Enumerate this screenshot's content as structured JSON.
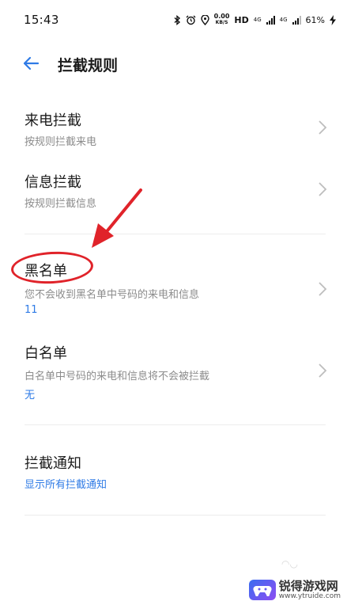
{
  "status_bar": {
    "time": "15:43",
    "net_speed_value": "0.00",
    "net_speed_unit": "KB/S",
    "hd_label": "HD",
    "network_1": "4G",
    "network_2": "4G",
    "battery": "61%"
  },
  "header": {
    "title": "拦截规则"
  },
  "rows": [
    {
      "title": "来电拦截",
      "subtitle": "按规则拦截来电"
    },
    {
      "title": "信息拦截",
      "subtitle": "按规则拦截信息"
    },
    {
      "title": "黑名单",
      "subtitle": "您不会收到黑名单中号码的来电和信息",
      "value": "11"
    },
    {
      "title": "白名单",
      "subtitle": "白名单中号码的来电和信息将不会被拦截",
      "value": "无"
    },
    {
      "title": "拦截通知",
      "value": "显示所有拦截通知"
    }
  ],
  "watermark": {
    "name": "锐得游戏网",
    "url": "www.ytruide.com"
  },
  "colors": {
    "accent": "#2f7be6",
    "annotation": "#e0232a"
  }
}
